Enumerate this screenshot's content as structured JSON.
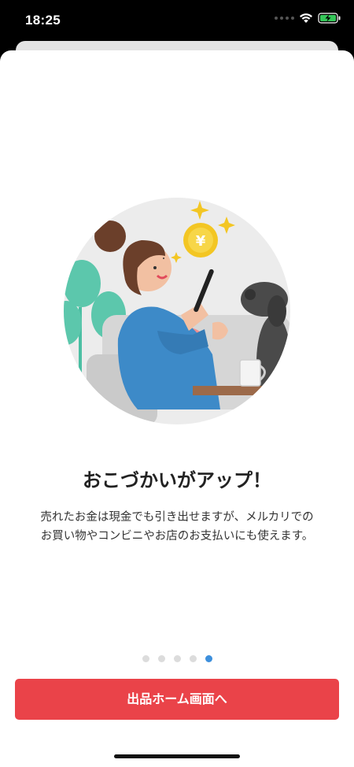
{
  "status_bar": {
    "time": "18:25",
    "icons": [
      "signal-icon",
      "wifi-icon",
      "battery-charging-icon"
    ]
  },
  "onboarding": {
    "illustration": "woman-with-phone-coin-dog-illustration",
    "coin_symbol": "¥",
    "headline": "おこづかいがアップ！",
    "description": "売れたお金は現金でも引き出せますが、メルカリでのお買い物やコンビニやお店のお支払いにも使えます。",
    "pager": {
      "total": 5,
      "active_index": 4
    },
    "cta_label": "出品ホーム画面へ"
  },
  "colors": {
    "accent": "#ea4349",
    "pager_active": "#3d8fdc",
    "pager_inactive": "#dcdcdc"
  }
}
